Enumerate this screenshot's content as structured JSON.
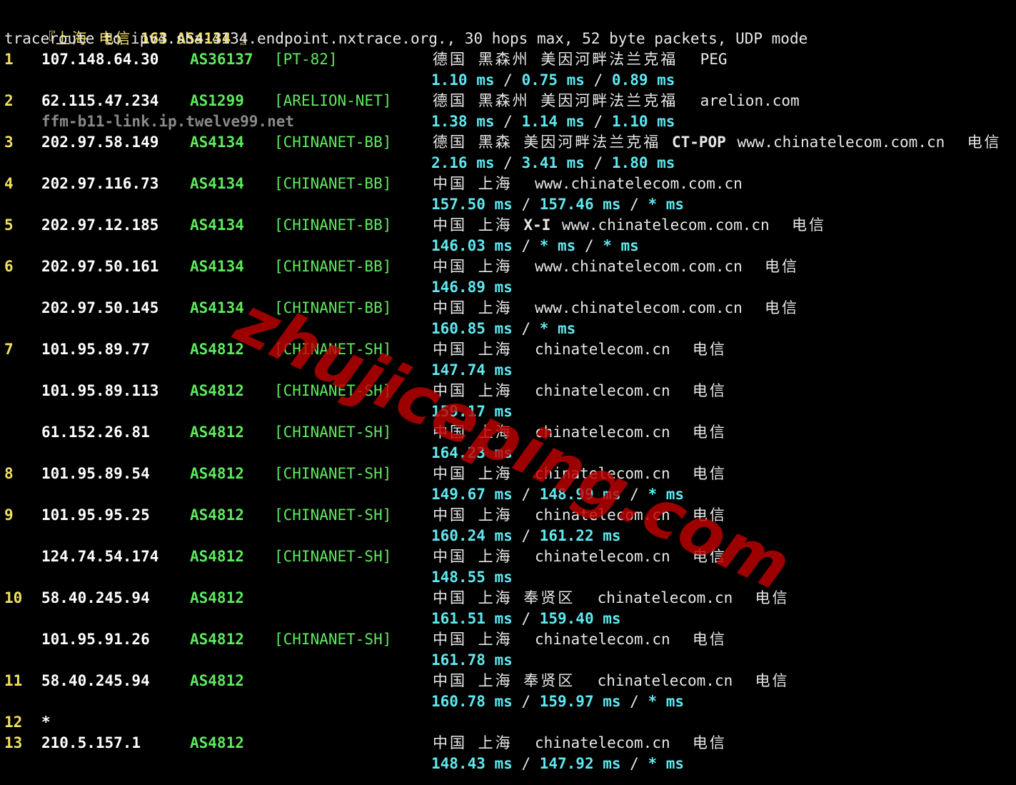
{
  "header": {
    "open_bracket": "『",
    "location": "上海 电信",
    "code": "163 AS4134",
    "close_bracket": "』"
  },
  "command": "traceroute to ipv4.sha-4134.endpoint.nxtrace.org., 30 hops max, 52 byte packets, UDP mode",
  "watermark": "zhujiceping.com",
  "colors": {
    "background": "#000000",
    "hop_number": "#f0e060",
    "asn": "#5fe85f",
    "rtt": "#5fe8f0",
    "watermark": "#c00000"
  },
  "hops": [
    {
      "hop": "1",
      "ip": "107.148.64.30",
      "asn": "AS36137",
      "tag": "[PT-82]",
      "geo": "德国 黑森州 美因河畔法兰克福",
      "org": "PEG",
      "rtt": [
        "1.10 ms",
        "0.75 ms",
        "0.89 ms"
      ]
    },
    {
      "hop": "2",
      "ip": "62.115.47.234",
      "asn": "AS1299",
      "tag": "[ARELION-NET]",
      "geo": "德国 黑森州 美因河畔法兰克福",
      "org": "arelion.com",
      "rdns": "ffm-b11-link.ip.twelve99.net",
      "rtt": [
        "1.38 ms",
        "1.14 ms",
        "1.10 ms"
      ]
    },
    {
      "hop": "3",
      "ip": "202.97.58.149",
      "asn": "AS4134",
      "tag": "[CHINANET-BB]",
      "geo": "德国 黑森 美因河畔法兰克福",
      "pop": "CT-POP",
      "domain": "www.chinatelecom.com.cn",
      "isp": "电信",
      "rtt": [
        "2.16 ms",
        "3.41 ms",
        "1.80 ms"
      ]
    },
    {
      "hop": "4",
      "ip": "202.97.116.73",
      "asn": "AS4134",
      "tag": "[CHINANET-BB]",
      "geo": "中国 上海",
      "domain": "www.chinatelecom.com.cn",
      "rtt": [
        "157.50 ms",
        "157.46 ms",
        "* ms"
      ]
    },
    {
      "hop": "5",
      "ip": "202.97.12.185",
      "asn": "AS4134",
      "tag": "[CHINANET-BB]",
      "geo": "中国 上海",
      "pop": "X-I",
      "domain": "www.chinatelecom.com.cn",
      "isp": "电信",
      "rtt": [
        "146.03 ms",
        "* ms",
        "* ms"
      ]
    },
    {
      "hop": "6",
      "ip": "202.97.50.161",
      "asn": "AS4134",
      "tag": "[CHINANET-BB]",
      "geo": "中国 上海",
      "domain": "www.chinatelecom.com.cn",
      "isp": "电信",
      "rtt": [
        "146.89 ms"
      ]
    },
    {
      "hop": "",
      "ip": "202.97.50.145",
      "asn": "AS4134",
      "tag": "[CHINANET-BB]",
      "geo": "中国 上海",
      "domain": "www.chinatelecom.com.cn",
      "isp": "电信",
      "rtt": [
        "160.85 ms",
        "* ms"
      ]
    },
    {
      "hop": "7",
      "ip": "101.95.89.77",
      "asn": "AS4812",
      "tag": "[CHINANET-SH]",
      "geo": "中国 上海",
      "domain": "chinatelecom.cn",
      "isp": "电信",
      "rtt": [
        "147.74 ms"
      ]
    },
    {
      "hop": "",
      "ip": "101.95.89.113",
      "asn": "AS4812",
      "tag": "[CHINANET-SH]",
      "geo": "中国 上海",
      "domain": "chinatelecom.cn",
      "isp": "电信",
      "rtt": [
        "159.17 ms"
      ]
    },
    {
      "hop": "",
      "ip": "61.152.26.81",
      "asn": "AS4812",
      "tag": "[CHINANET-SH]",
      "geo": "中国 上海",
      "domain": "chinatelecom.cn",
      "isp": "电信",
      "rtt": [
        "164.23 ms"
      ]
    },
    {
      "hop": "8",
      "ip": "101.95.89.54",
      "asn": "AS4812",
      "tag": "[CHINANET-SH]",
      "geo": "中国 上海",
      "domain": "chinatelecom.cn",
      "isp": "电信",
      "rtt": [
        "149.67 ms",
        "148.99 ms",
        "* ms"
      ]
    },
    {
      "hop": "9",
      "ip": "101.95.95.25",
      "asn": "AS4812",
      "tag": "[CHINANET-SH]",
      "geo": "中国 上海",
      "domain": "chinatelecom.cn",
      "isp": "电信",
      "rtt": [
        "160.24 ms",
        "161.22 ms"
      ]
    },
    {
      "hop": "",
      "ip": "124.74.54.174",
      "asn": "AS4812",
      "tag": "[CHINANET-SH]",
      "geo": "中国 上海",
      "domain": "chinatelecom.cn",
      "isp": "电信",
      "rtt": [
        "148.55 ms"
      ]
    },
    {
      "hop": "10",
      "ip": "58.40.245.94",
      "asn": "AS4812",
      "tag": "",
      "geo": "中国 上海 奉贤区",
      "domain": "chinatelecom.cn",
      "isp": "电信",
      "rtt": [
        "161.51 ms",
        "159.40 ms"
      ]
    },
    {
      "hop": "",
      "ip": "101.95.91.26",
      "asn": "AS4812",
      "tag": "[CHINANET-SH]",
      "geo": "中国 上海",
      "domain": "chinatelecom.cn",
      "isp": "电信",
      "rtt": [
        "161.78 ms"
      ]
    },
    {
      "hop": "11",
      "ip": "58.40.245.94",
      "asn": "AS4812",
      "tag": "",
      "geo": "中国 上海 奉贤区",
      "domain": "chinatelecom.cn",
      "isp": "电信",
      "rtt": [
        "160.78 ms",
        "159.97 ms",
        "* ms"
      ]
    },
    {
      "hop": "12",
      "timeout": "*"
    },
    {
      "hop": "13",
      "ip": "210.5.157.1",
      "asn": "AS4812",
      "tag": "",
      "geo": "中国 上海",
      "domain": "chinatelecom.cn",
      "isp": "电信",
      "rtt": [
        "148.43 ms",
        "147.92 ms",
        "* ms"
      ]
    }
  ]
}
